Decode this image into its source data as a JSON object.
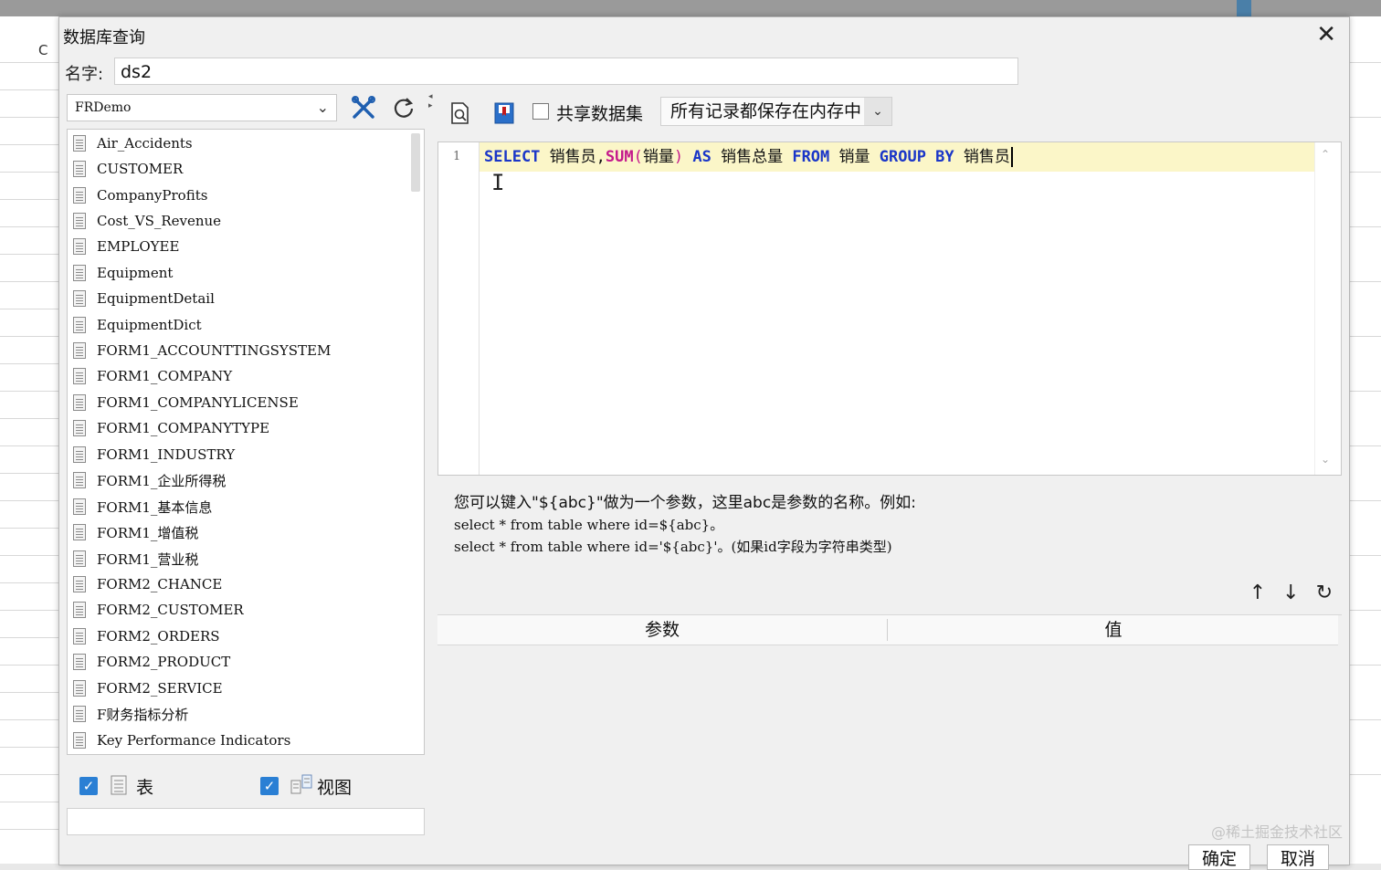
{
  "background": {
    "column_letter": "C"
  },
  "dialog": {
    "title": "数据库查询",
    "name_label": "名字:",
    "name_value": "ds2"
  },
  "datasource": {
    "selected": "FRDemo",
    "tables": [
      "Air_Accidents",
      "CUSTOMER",
      "CompanyProfits",
      "Cost_VS_Revenue",
      "EMPLOYEE",
      "Equipment",
      "EquipmentDetail",
      "EquipmentDict",
      "FORM1_ACCOUNTTINGSYSTEM",
      "FORM1_COMPANY",
      "FORM1_COMPANYLICENSE",
      "FORM1_COMPANYTYPE",
      "FORM1_INDUSTRY",
      "FORM1_企业所得税",
      "FORM1_基本信息",
      "FORM1_增值税",
      "FORM1_营业税",
      "FORM2_CHANCE",
      "FORM2_CUSTOMER",
      "FORM2_ORDERS",
      "FORM2_PRODUCT",
      "FORM2_SERVICE",
      "F财务指标分析",
      "Key Performance Indicators"
    ],
    "filter_table_label": "表",
    "filter_view_label": "视图"
  },
  "toolbar": {
    "share_label": "共享数据集",
    "cache_option": "所有记录都保存在内存中"
  },
  "editor": {
    "line_number": "1",
    "sql": {
      "t1": "SELECT",
      "t2": " 销售员,",
      "t3": "SUM",
      "t4": "(",
      "t5": "销量",
      "t6": ")",
      "t7": " AS ",
      "t8": "销售总量 ",
      "t9": "FROM",
      "t10": " 销量 ",
      "t11": "GROUP BY",
      "t12": " 销售员"
    }
  },
  "hint": {
    "line1": "您可以键入\"${abc}\"做为一个参数，这里abc是参数的名称。例如:",
    "line2": "select * from table where id=${abc}。",
    "line3": "select * from table where id='${abc}'。(如果id字段为字符串类型)"
  },
  "params": {
    "col_param": "参数",
    "col_value": "值"
  },
  "buttons": {
    "ok": "确定",
    "cancel": "取消"
  },
  "watermark": "@稀土掘金技术社区",
  "colors": {
    "keyword": "#1a36c8",
    "function": "#c41a8c",
    "line_highlight": "#fbf6c8",
    "checkbox": "#2a7fd4"
  }
}
